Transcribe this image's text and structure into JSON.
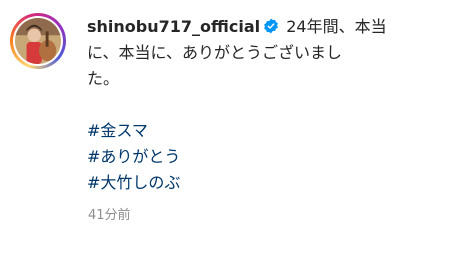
{
  "comment": {
    "username": "shinobu717_official",
    "caption_line1": "24年間、本当",
    "caption_line2": "に、本当に、ありがとうございまし",
    "caption_line3": "た。",
    "hashtags": [
      "#金スマ",
      "#ありがとう",
      "#大竹しのぶ"
    ],
    "timestamp": "41分前",
    "verified_icon": "verified-badge-icon",
    "colors": {
      "hashtag": "#00376b",
      "verified": "#0095f6",
      "timestamp": "#8e8e8e"
    }
  }
}
